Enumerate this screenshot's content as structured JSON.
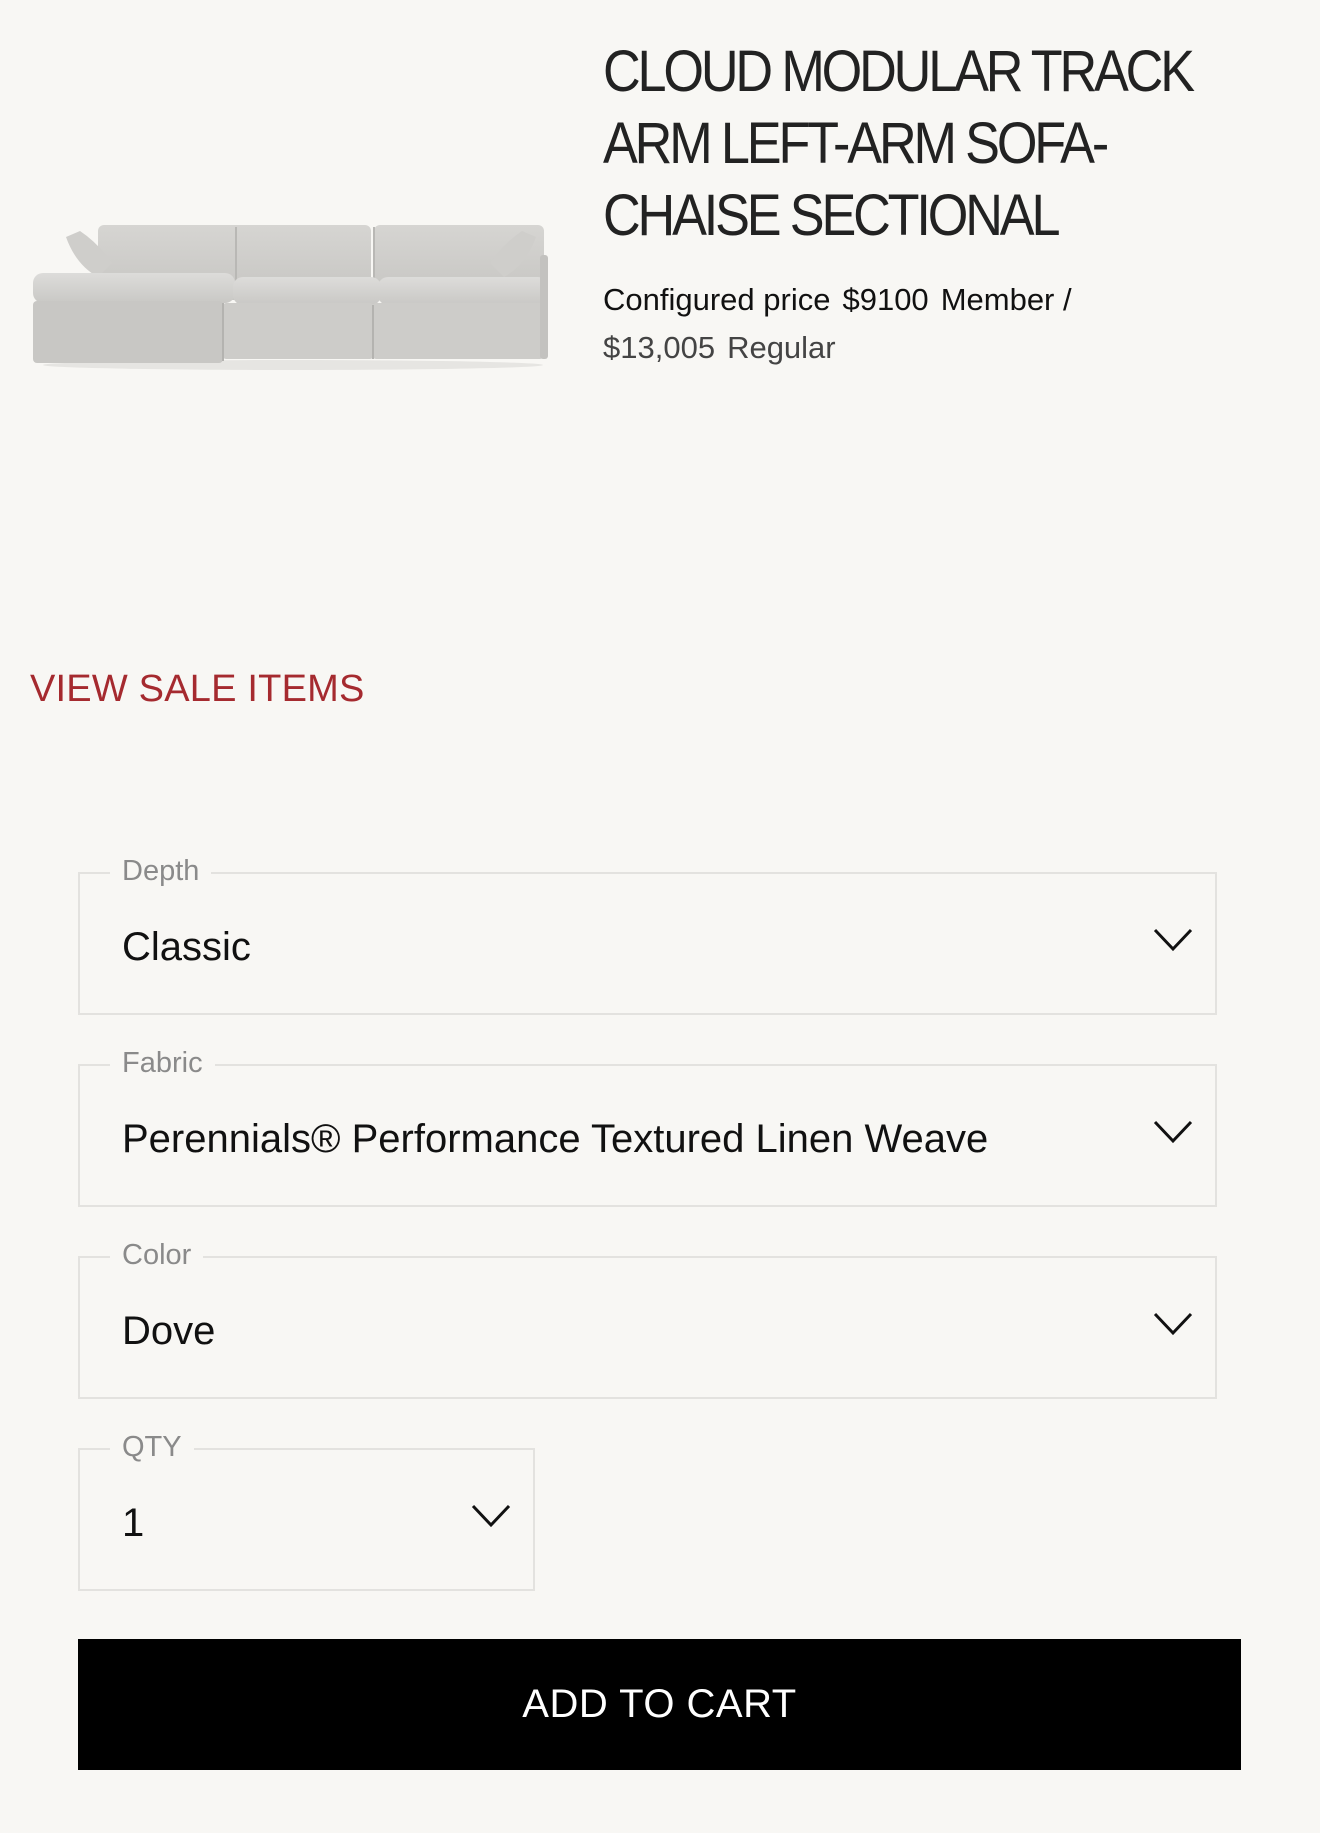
{
  "product": {
    "title": "CLOUD MODULAR TRACK ARM LEFT-ARM SOFA-CHAISE SECTIONAL",
    "price": {
      "configured_label": "Configured price",
      "member_price": "$9100",
      "member_label": "Member /",
      "regular_price": "$13,005",
      "regular_label": "Regular"
    }
  },
  "sale_link": "VIEW SALE ITEMS",
  "options": {
    "depth": {
      "label": "Depth",
      "value": "Classic"
    },
    "fabric": {
      "label": "Fabric",
      "value": "Perennials® Performance Textured Linen Weave"
    },
    "color": {
      "label": "Color",
      "value": "Dove"
    },
    "qty": {
      "label": "QTY",
      "value": "1"
    }
  },
  "add_to_cart": "ADD TO CART",
  "colors": {
    "background": "#f8f7f4",
    "sale_link": "#a52a2f",
    "button": "#000000",
    "field_border": "#e3e2df"
  },
  "icons": {
    "product_image": "sofa-sectional-image",
    "dropdown": "chevron-down-icon"
  }
}
